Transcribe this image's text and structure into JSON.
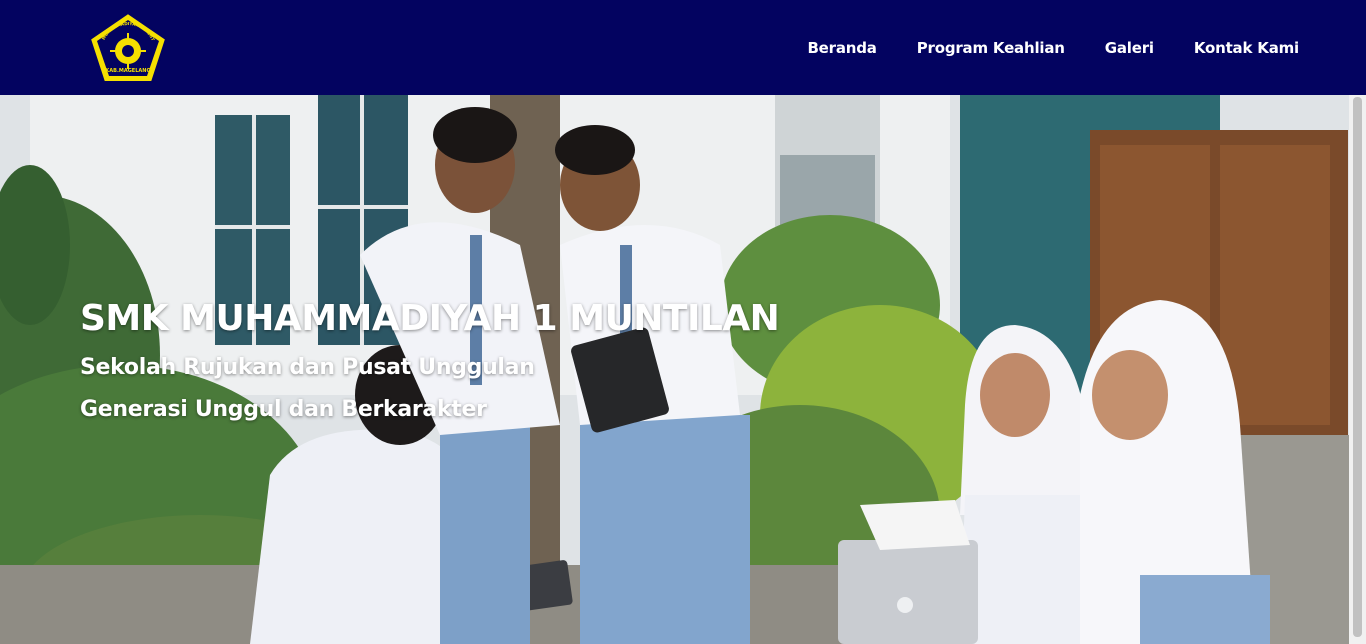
{
  "brand": {
    "logo_icon": "school-logo-icon",
    "logo_text_top": "SMK MUHAMMADIYAH 1 MUNTILAN",
    "logo_text_bottom": "KAB.MAGELANG",
    "navbar_color": "#030360",
    "logo_color": "#f5e000"
  },
  "nav": {
    "items": [
      {
        "label": "Beranda"
      },
      {
        "label": "Program Keahlian"
      },
      {
        "label": "Galeri"
      },
      {
        "label": "Kontak Kami"
      }
    ]
  },
  "hero": {
    "title": "SMK MUHAMMADIYAH 1 MUNTILAN",
    "subtitle_1": "Sekolah Rujukan dan Pusat Unggulan",
    "subtitle_2": "Generasi Unggul dan Berkarakter"
  }
}
